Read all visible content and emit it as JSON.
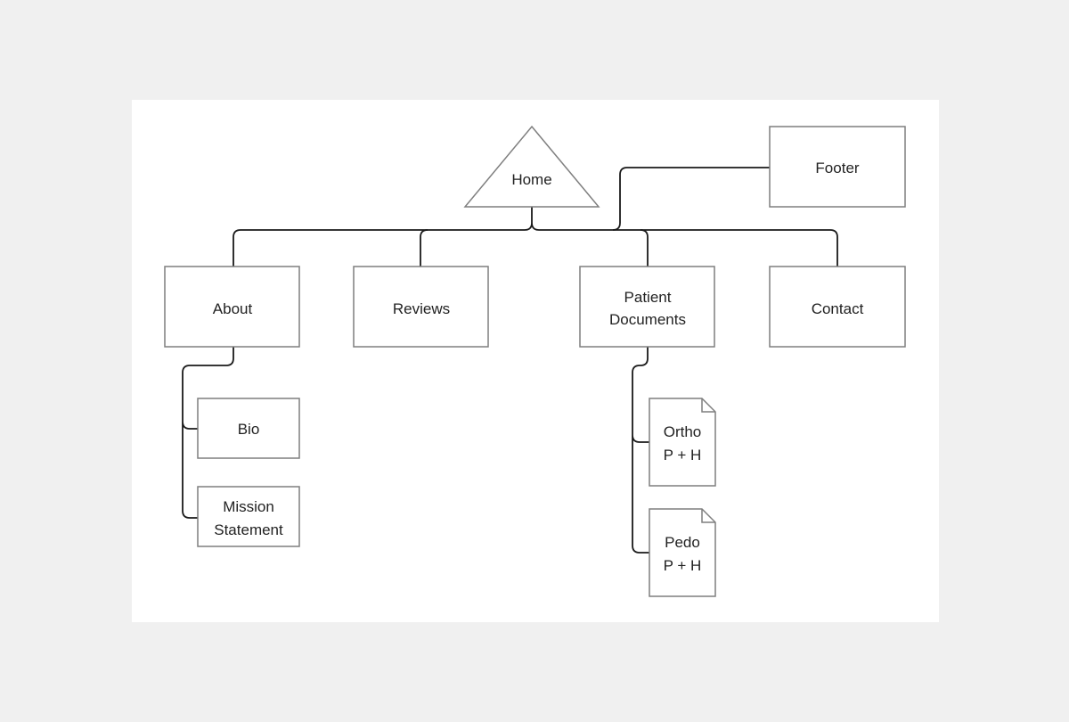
{
  "diagram": {
    "home": "Home",
    "footer": "Footer",
    "pages": {
      "about": "About",
      "reviews": "Reviews",
      "patient_documents": [
        "Patient",
        "Documents"
      ],
      "contact": "Contact"
    },
    "about_children": {
      "bio": "Bio",
      "mission_statement": [
        "Mission",
        "Statement"
      ]
    },
    "document_children": {
      "ortho": [
        "Ortho",
        "P + H"
      ],
      "pedo": [
        "Pedo",
        "P + H"
      ]
    }
  }
}
